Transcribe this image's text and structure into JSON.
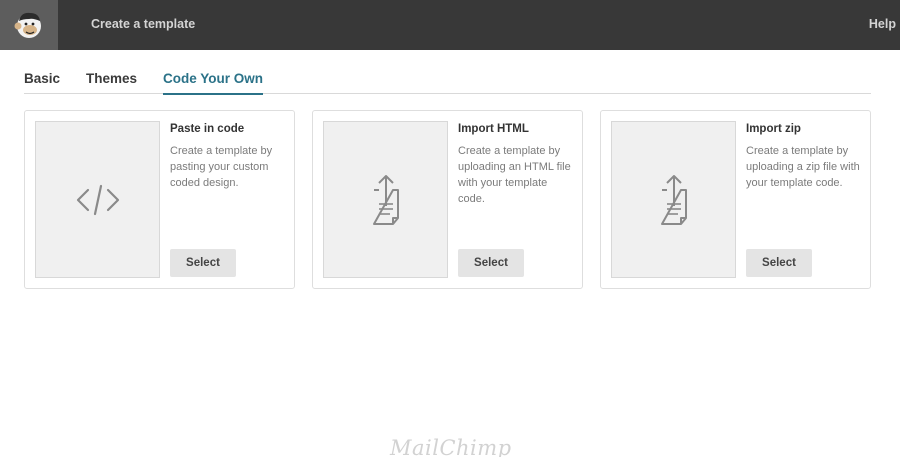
{
  "header": {
    "title": "Create a template",
    "help_label": "Help",
    "logo_icon": "chimp-logo-icon"
  },
  "tabs": [
    {
      "label": "Basic",
      "active": false
    },
    {
      "label": "Themes",
      "active": false
    },
    {
      "label": "Code Your Own",
      "active": true
    }
  ],
  "cards": [
    {
      "title": "Paste in code",
      "description": "Create a template by pasting your custom coded design.",
      "button_label": "Select",
      "icon": "code-icon"
    },
    {
      "title": "Import HTML",
      "description": "Create a template by uploading an HTML file with your template code.",
      "button_label": "Select",
      "icon": "upload-file-icon"
    },
    {
      "title": "Import zip",
      "description": "Create a template by uploading a zip file with your template code.",
      "button_label": "Select",
      "icon": "upload-file-icon"
    }
  ],
  "footer": {
    "brand": "MailChimp"
  },
  "colors": {
    "topbar": "#383838",
    "active_tab": "#2b7288",
    "button_bg": "#e4e4e4"
  }
}
